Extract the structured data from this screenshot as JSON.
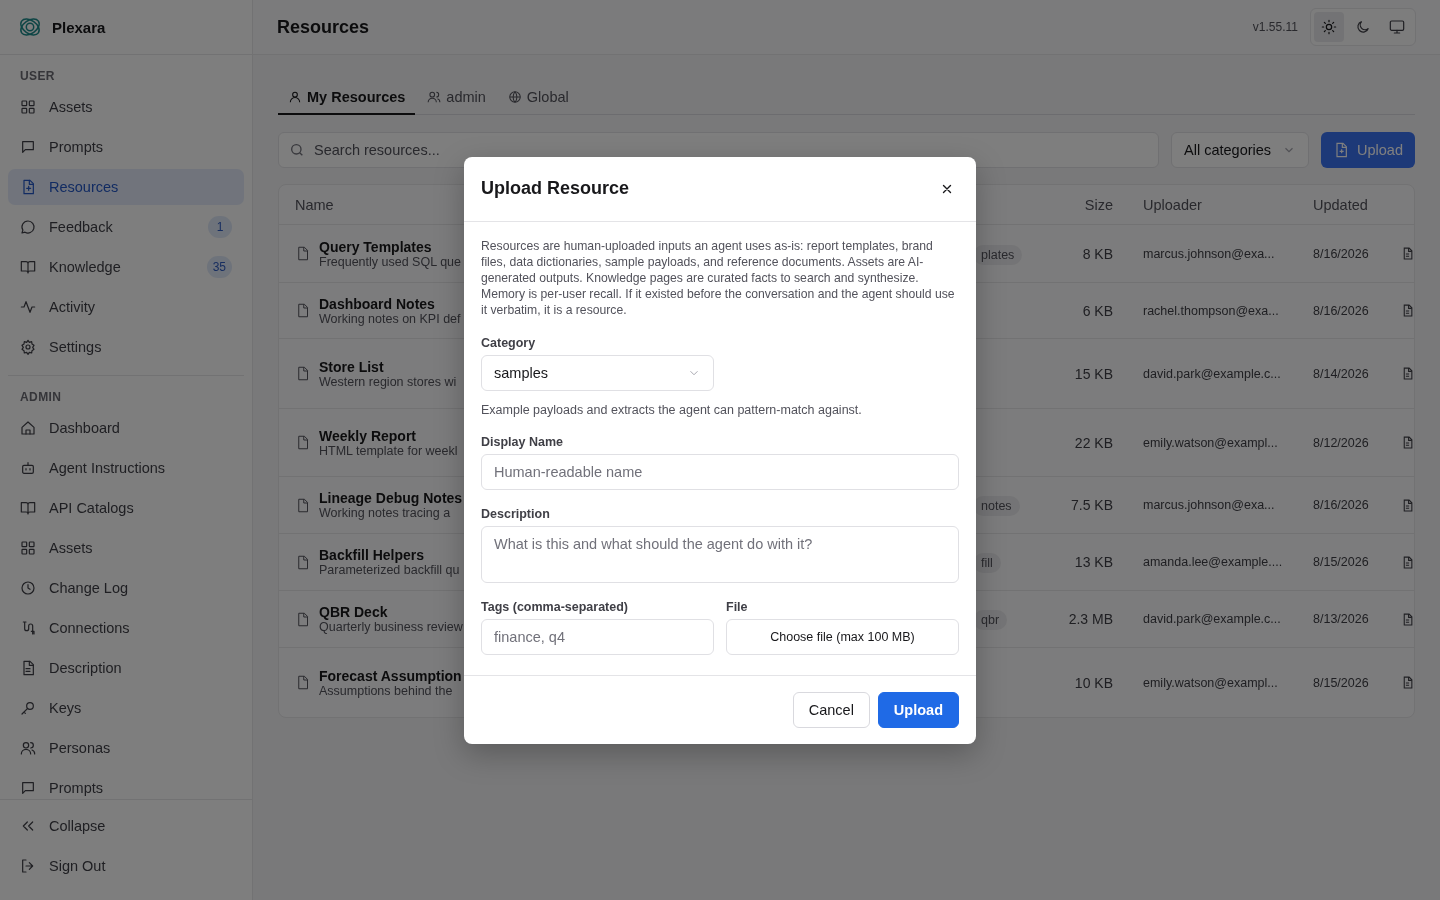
{
  "app": {
    "name": "Plexara"
  },
  "sidebar": {
    "sections": [
      {
        "label": "USER",
        "items": [
          {
            "label": "Assets",
            "selected": false
          },
          {
            "label": "Prompts",
            "selected": false
          },
          {
            "label": "Resources",
            "selected": true
          },
          {
            "label": "Feedback",
            "selected": false,
            "badge": "1"
          },
          {
            "label": "Knowledge",
            "selected": false,
            "badge": "35"
          },
          {
            "label": "Activity",
            "selected": false
          },
          {
            "label": "Settings",
            "selected": false
          }
        ]
      },
      {
        "label": "ADMIN",
        "items": [
          {
            "label": "Dashboard",
            "selected": false
          },
          {
            "label": "Agent Instructions",
            "selected": false
          },
          {
            "label": "API Catalogs",
            "selected": false
          },
          {
            "label": "Assets",
            "selected": false
          },
          {
            "label": "Change Log",
            "selected": false
          },
          {
            "label": "Connections",
            "selected": false
          },
          {
            "label": "Description",
            "selected": false
          },
          {
            "label": "Keys",
            "selected": false
          },
          {
            "label": "Personas",
            "selected": false
          },
          {
            "label": "Prompts",
            "selected": false
          }
        ]
      }
    ],
    "footer": [
      {
        "label": "Collapse"
      },
      {
        "label": "Sign Out"
      }
    ]
  },
  "header": {
    "title": "Resources",
    "version": "v1.55.11",
    "theme_modes": [
      {
        "selected": true
      },
      {
        "selected": false
      },
      {
        "selected": false
      }
    ]
  },
  "tabs": [
    {
      "label": "My Resources",
      "selected": true
    },
    {
      "label": "admin",
      "selected": false
    },
    {
      "label": "Global",
      "selected": false
    }
  ],
  "search": {
    "placeholder": "Search resources..."
  },
  "category_filter": {
    "value": "All categories"
  },
  "upload_button": {
    "label": "Upload"
  },
  "table": {
    "columns": [
      "Name",
      "Size",
      "Uploader",
      "Updated"
    ],
    "rows": [
      {
        "name": "Query Templates",
        "description": "Frequently used SQL que",
        "tag": "plates",
        "size": "8 KB",
        "uploader": "marcus.johnson@exa...",
        "updated": "8/16/2026"
      },
      {
        "name": "Dashboard Notes",
        "description": "Working notes on KPI def",
        "size": "6 KB",
        "uploader": "rachel.thompson@exa...",
        "updated": "8/16/2026"
      },
      {
        "name": "Store List",
        "description": "Western region stores wi",
        "size": "15 KB",
        "uploader": "david.park@example.c...",
        "updated": "8/14/2026"
      },
      {
        "name": "Weekly Report",
        "description": "HTML template for weekl",
        "size": "22 KB",
        "uploader": "emily.watson@exampl...",
        "updated": "8/12/2026"
      },
      {
        "name": "Lineage Debug Notes",
        "description": "Working notes tracing a",
        "tag": "notes",
        "size": "7.5 KB",
        "uploader": "marcus.johnson@exa...",
        "updated": "8/16/2026"
      },
      {
        "name": "Backfill Helpers",
        "description": "Parameterized backfill qu",
        "tag": "fill",
        "size": "13 KB",
        "uploader": "amanda.lee@example....",
        "updated": "8/15/2026"
      },
      {
        "name": "QBR Deck",
        "description": "Quarterly business review",
        "tag": "qbr",
        "size": "2.3 MB",
        "uploader": "david.park@example.c...",
        "updated": "8/13/2026"
      },
      {
        "name": "Forecast Assumption",
        "description": "Assumptions behind the",
        "size": "10 KB",
        "uploader": "emily.watson@exampl...",
        "updated": "8/15/2026"
      }
    ]
  },
  "dialog": {
    "title": "Upload Resource",
    "intro": "Resources are human-uploaded inputs an agent uses as-is: report templates, brand files, data dictionaries, sample payloads, and reference documents. Assets are AI-generated outputs. Knowledge pages are curated facts to search and synthesize. Memory is per-user recall. If it existed before the conversation and the agent should use it verbatim, it is a resource.",
    "category": {
      "label": "Category",
      "value": "samples",
      "hint": "Example payloads and extracts the agent can pattern-match against."
    },
    "display_name": {
      "label": "Display Name",
      "placeholder": "Human-readable name"
    },
    "description": {
      "label": "Description",
      "placeholder": "What is this and what should the agent do with it?"
    },
    "tags": {
      "label": "Tags (comma-separated)",
      "placeholder": "finance, q4"
    },
    "file": {
      "label": "File",
      "button": "Choose file (max 100 MB)"
    },
    "buttons": [
      {
        "label": "Cancel",
        "kind": "secondary"
      },
      {
        "label": "Upload",
        "kind": "primary"
      }
    ]
  }
}
